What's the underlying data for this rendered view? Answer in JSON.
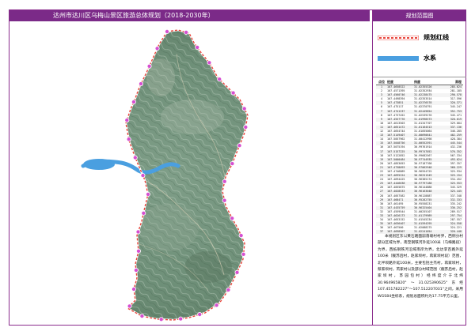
{
  "title": "达州市达川区乌梅山景区旅游总体规划（2018-2030年）",
  "panel_title": "规划范围图",
  "legend": [
    {
      "label": "规划红线",
      "color": "#e8453c",
      "style": "boundary"
    },
    {
      "label": "水系",
      "color": "#4a9fe0",
      "style": "water"
    }
  ],
  "colors": {
    "accent": "#7b2a88",
    "boundary": "#e8453c",
    "marker": "#d64fd1",
    "water": "#4a9fe0"
  },
  "table": {
    "headers": [
      "点位",
      "经度",
      "纬度",
      "高程"
    ],
    "rows": [
      [
        "1",
        "107.4658522",
        "31.02355326",
        "285.624"
      ],
      [
        "2",
        "107.4571395",
        "31.02352934",
        "281.185"
      ],
      [
        "3",
        "107.4560746",
        "31.02238475",
        "290.578"
      ],
      [
        "4",
        "107.4498394",
        "31.02353514",
        "317.596"
      ],
      [
        "5",
        "107.473851",
        "31.02376578",
        "320.371"
      ],
      [
        "6",
        "107.475117",
        "31.02370791",
        "345.247"
      ],
      [
        "7",
        "107.4741237",
        "31.02449854",
        "352.753"
      ],
      [
        "8",
        "107.4737452",
        "31.02539276",
        "345.471"
      ],
      [
        "9",
        "107.4557776",
        "31.01998573",
        "320.619"
      ],
      [
        "10",
        "107.4613503",
        "31.01347707",
        "329.004"
      ],
      [
        "11",
        "107.4651472",
        "31.01164513",
        "337.136"
      ],
      [
        "12",
        "107.4654744",
        "31.01055064",
        "346.285"
      ],
      [
        "13",
        "107.5149407",
        "31.00690641",
        "402.259"
      ],
      [
        "14",
        "107.5057962",
        "31.00412998",
        "428.384"
      ],
      [
        "15",
        "107.5048756",
        "31.00552591",
        "445.544"
      ],
      [
        "16",
        "107.5075194",
        "30.99761914",
        "432.236"
      ],
      [
        "17",
        "107.5157225",
        "30.99747052",
        "576.352"
      ],
      [
        "18",
        "107.5122852",
        "30.99682567",
        "567.334"
      ],
      [
        "19",
        "107.5000484",
        "30.97744935",
        "493.624"
      ],
      [
        "20",
        "107.4853053",
        "30.97187768",
        "397.357"
      ],
      [
        "21",
        "107.4738093",
        "30.97062948",
        "368.229"
      ],
      [
        "22",
        "107.4746889",
        "30.96554725",
        "325.934"
      ],
      [
        "23",
        "107.4695224",
        "30.96251549",
        "325.154"
      ],
      [
        "24",
        "107.4694425",
        "30.96385174",
        "334.452"
      ],
      [
        "25",
        "107.4446038",
        "30.97797188",
        "325.553"
      ],
      [
        "26",
        "107.4055875",
        "30.96144888",
        "345.329"
      ],
      [
        "27",
        "107.4028533",
        "30.96163048",
        "325.445"
      ],
      [
        "28",
        "107.4057582",
        "30.96128887",
        "337.348"
      ],
      [
        "29",
        "107.468471",
        "30.95282755",
        "332.333"
      ],
      [
        "30",
        "107.461495",
        "30.95558231",
        "335.242"
      ],
      [
        "31",
        "107.4435759",
        "30.96325404",
        "336.252"
      ],
      [
        "32",
        "107.4559544",
        "31.00255107",
        "289.517"
      ],
      [
        "33",
        "107.4626173",
        "31.01179989",
        "297.754"
      ],
      [
        "34",
        "107.4653152",
        "31.01545234",
        "287.557"
      ],
      [
        "35",
        "107.4636407",
        "31.01594295",
        "324.558"
      ],
      [
        "36",
        "107.467500",
        "31.02088275",
        "324.221"
      ],
      [
        "37",
        "107.4698907",
        "31.02241054",
        "320.448"
      ]
    ]
  },
  "description": "本规划区东以黄石路面崩落坡村村界，西侧分村部分区域为界，南至钢铁河外延100米（乌梅路段）为界，西抵钢铁河沿域南岸为界，北达李百路外延100米（靓苏后村，赵家坝村，蒋家坝村段）范围，北半坝路外延100米，主要包括主杰村，蒋家坝村，蔡家坝村，芮家村以及部分村域范围（靓苏后村，赵家坝村，苏园包村）经纬度介于北纬30.964965820°～31.025390625°东经107.451782227°～107.512207031°之间，采用WGS84坐标系，规划总面积约为17.75平方公里。"
}
